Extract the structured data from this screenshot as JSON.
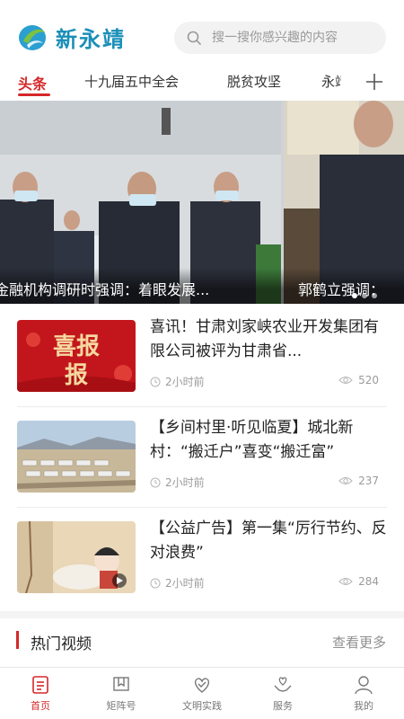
{
  "header": {
    "app_name": "新永靖",
    "search_placeholder": "搜一搜你感兴趣的内容"
  },
  "tabs": [
    {
      "label": "头条",
      "active": true
    },
    {
      "label": "十九届五中全会",
      "active": false
    },
    {
      "label": "脱贫攻坚",
      "active": false
    },
    {
      "label": "永靖",
      "active": false
    }
  ],
  "banner": {
    "slides": [
      {
        "caption": "金融机构调研时强调：着眼发展..."
      },
      {
        "caption": "郭鹤立强调："
      }
    ],
    "dot_count": 3
  },
  "news": [
    {
      "title": "喜讯！甘肃刘家峡农业开发集团有限公司被评为甘肃省...",
      "time": "2小时前",
      "views": "520",
      "thumb_text": "喜报"
    },
    {
      "title": "【乡间村里·听见临夏】城北新村：“搬迁户”喜变“搬迁富”",
      "time": "2小时前",
      "views": "237"
    },
    {
      "title": "【公益广告】第一集“厉行节约、反对浪费”",
      "time": "2小时前",
      "views": "284"
    }
  ],
  "section": {
    "title": "热门视频",
    "more": "查看更多"
  },
  "bottom_nav": [
    {
      "label": "首页",
      "icon": "home-icon",
      "active": true
    },
    {
      "label": "矩阵号",
      "icon": "bookmark-icon",
      "active": false
    },
    {
      "label": "文明实践",
      "icon": "heart-icon",
      "active": false
    },
    {
      "label": "服务",
      "icon": "hands-heart-icon",
      "active": false
    },
    {
      "label": "我的",
      "icon": "user-icon",
      "active": false
    }
  ],
  "colors": {
    "accent": "#d5282a",
    "brand": "#1a8fb8"
  }
}
